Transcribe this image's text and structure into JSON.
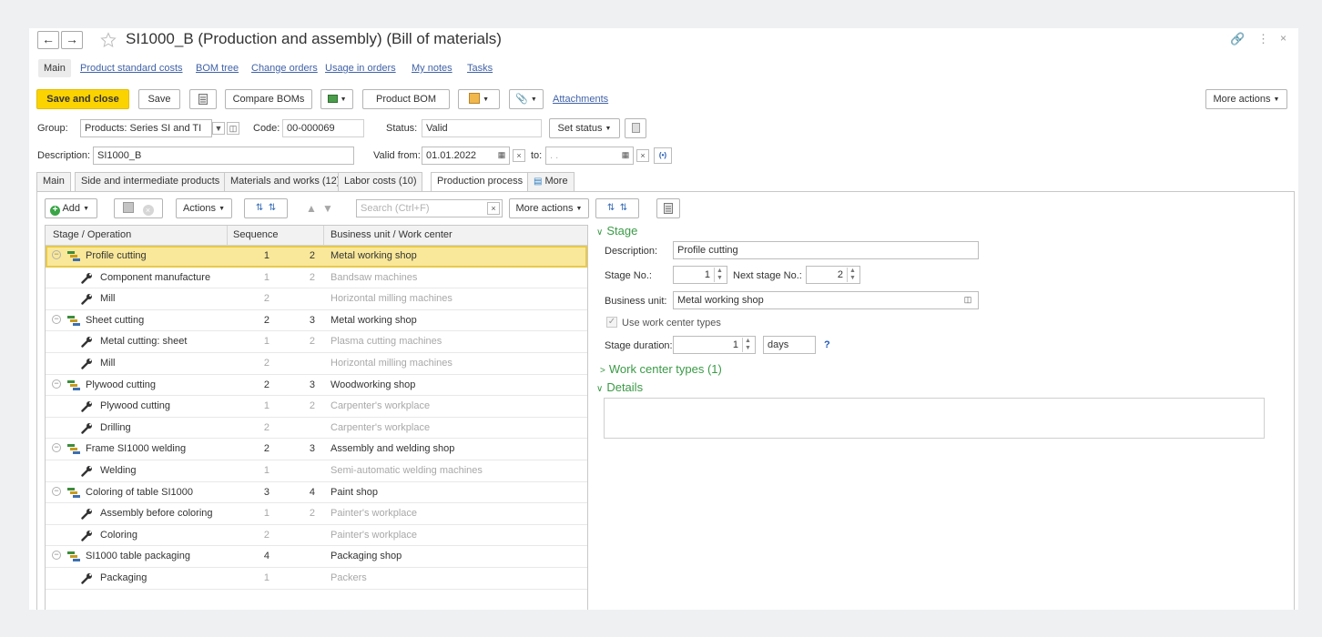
{
  "window": {
    "title": "SI1000_B (Production and assembly) (Bill of materials)",
    "controls": {
      "link": "🔗",
      "menu": "⋮",
      "close": "×"
    }
  },
  "form_tabs": [
    {
      "label": "Main",
      "active": true
    },
    {
      "label": "Product standard costs"
    },
    {
      "label": "BOM tree"
    },
    {
      "label": "Change orders"
    },
    {
      "label": "Usage in orders"
    },
    {
      "label": "My notes"
    },
    {
      "label": "Tasks"
    }
  ],
  "toolbar": {
    "save_close": "Save and close",
    "save": "Save",
    "compare": "Compare BOMs",
    "product_bom": "Product BOM",
    "attachments": "Attachments",
    "more_actions": "More actions"
  },
  "header": {
    "group_label": "Group:",
    "group_value": "Products: Series SI and TI",
    "code_label": "Code:",
    "code_value": "00-000069",
    "status_label": "Status:",
    "status_value": "Valid",
    "set_status": "Set status",
    "description_label": "Description:",
    "description_value": "SI1000_B",
    "valid_from_label": "Valid from:",
    "valid_from_value": "01.01.2022",
    "to_label": "to:",
    "to_value": " .  ."
  },
  "object_tabs": [
    {
      "label": "Main"
    },
    {
      "label": "Side and intermediate products"
    },
    {
      "label": "Materials and works (12)"
    },
    {
      "label": "Labor costs (10)"
    },
    {
      "label": "Production process",
      "active": true
    },
    {
      "label": "More"
    }
  ],
  "list_toolbar": {
    "add": "Add",
    "actions": "Actions",
    "search_placeholder": "Search (Ctrl+F)",
    "more_actions": "More actions"
  },
  "table": {
    "columns": [
      "Stage / Operation",
      "Sequence",
      "Business unit / Work center"
    ],
    "rows": [
      {
        "type": "stage",
        "name": "Profile cutting",
        "seq1": "1",
        "seq2": "2",
        "unit": "Metal working shop",
        "selected": true
      },
      {
        "type": "op",
        "name": "Component manufacture",
        "seq1": "1",
        "seq2": "2",
        "unit": "Bandsaw machines"
      },
      {
        "type": "op",
        "name": "Mill",
        "seq1": "2",
        "seq2": "",
        "unit": "Horizontal milling machines"
      },
      {
        "type": "stage",
        "name": "Sheet cutting",
        "seq1": "2",
        "seq2": "3",
        "unit": "Metal working shop"
      },
      {
        "type": "op",
        "name": "Metal cutting: sheet",
        "seq1": "1",
        "seq2": "2",
        "unit": "Plasma cutting machines"
      },
      {
        "type": "op",
        "name": "Mill",
        "seq1": "2",
        "seq2": "",
        "unit": "Horizontal milling machines"
      },
      {
        "type": "stage",
        "name": "Plywood cutting",
        "seq1": "2",
        "seq2": "3",
        "unit": "Woodworking shop"
      },
      {
        "type": "op",
        "name": "Plywood cutting",
        "seq1": "1",
        "seq2": "2",
        "unit": "Carpenter's workplace"
      },
      {
        "type": "op",
        "name": "Drilling",
        "seq1": "2",
        "seq2": "",
        "unit": "Carpenter's workplace"
      },
      {
        "type": "stage",
        "name": "Frame SI1000 welding",
        "seq1": "2",
        "seq2": "3",
        "unit": "Assembly and welding shop"
      },
      {
        "type": "op",
        "name": "Welding",
        "seq1": "1",
        "seq2": "",
        "unit": "Semi-automatic welding machines"
      },
      {
        "type": "stage",
        "name": "Coloring of table SI1000",
        "seq1": "3",
        "seq2": "4",
        "unit": "Paint shop"
      },
      {
        "type": "op",
        "name": "Assembly before coloring",
        "seq1": "1",
        "seq2": "2",
        "unit": "Painter's workplace"
      },
      {
        "type": "op",
        "name": "Coloring",
        "seq1": "2",
        "seq2": "",
        "unit": "Painter's workplace"
      },
      {
        "type": "stage",
        "name": "SI1000 table packaging",
        "seq1": "4",
        "seq2": "",
        "unit": "Packaging shop"
      },
      {
        "type": "op",
        "name": "Packaging",
        "seq1": "1",
        "seq2": "",
        "unit": "Packers"
      }
    ]
  },
  "stage_form": {
    "section": "Stage",
    "description_label": "Description:",
    "description_value": "Profile cutting",
    "stage_no_label": "Stage No.:",
    "stage_no_value": "1",
    "next_stage_label": "Next stage No.:",
    "next_stage_value": "2",
    "business_unit_label": "Business unit:",
    "business_unit_value": "Metal working shop",
    "use_wc_types_label": "Use work center types",
    "use_wc_types_checked": true,
    "duration_label": "Stage duration:",
    "duration_value": "1",
    "duration_unit": "days",
    "help": "?",
    "work_center_types": "Work center types (1)",
    "details": "Details"
  },
  "colors": {
    "accent_yellow": "#fbd300",
    "link_blue": "#4062a8",
    "section_green": "#3a9a46",
    "selection": "#f9e89a"
  }
}
